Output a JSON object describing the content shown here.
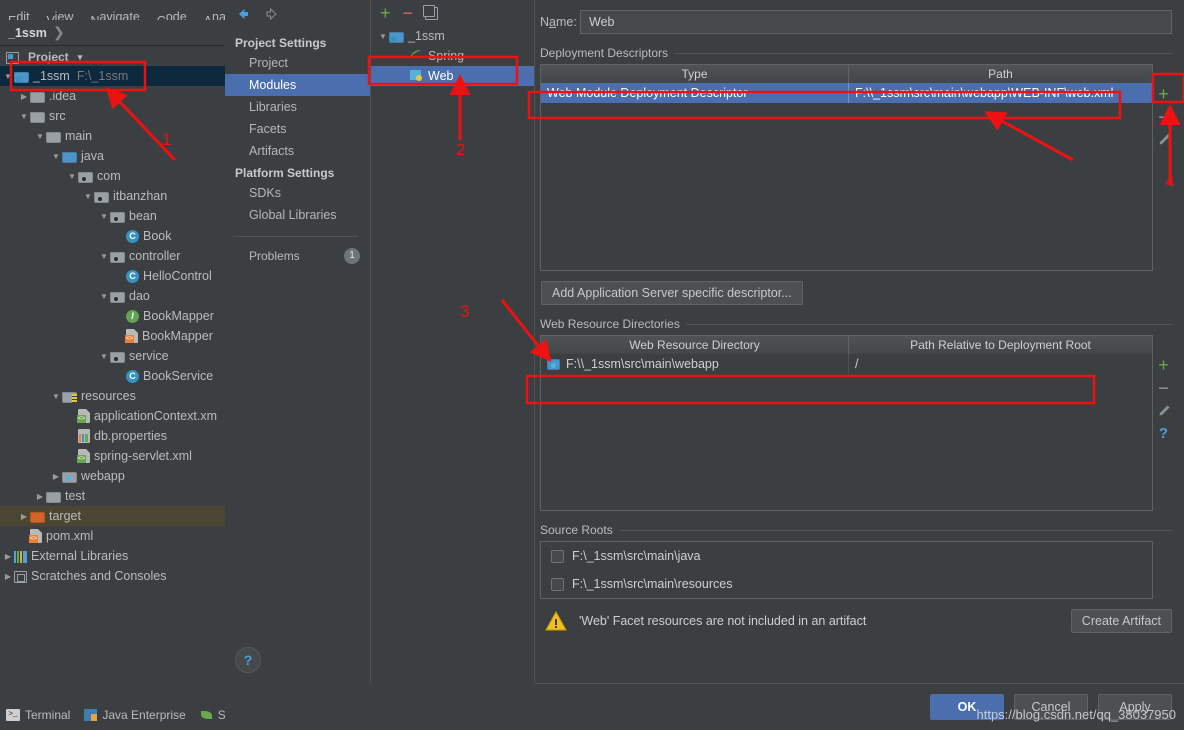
{
  "ide": {
    "menubar": [
      "Edit",
      "View",
      "Navigate",
      "Code",
      "Analyz"
    ],
    "breadcrumb": "_1ssm",
    "project_panel_title": "Project",
    "tree": [
      {
        "label": "_1ssm",
        "sub": "F:\\_1ssm",
        "icon": "module-folder-icon",
        "indent": 0,
        "twist": "down",
        "state": "selected"
      },
      {
        "label": ".idea",
        "sub": "",
        "icon": "folder-icon",
        "indent": 1,
        "twist": "right",
        "state": ""
      },
      {
        "label": "src",
        "sub": "",
        "icon": "folder-icon",
        "indent": 1,
        "twist": "down",
        "state": ""
      },
      {
        "label": "main",
        "sub": "",
        "icon": "folder-icon",
        "indent": 2,
        "twist": "down",
        "state": ""
      },
      {
        "label": "java",
        "sub": "",
        "icon": "source-folder-icon",
        "indent": 3,
        "twist": "down",
        "state": ""
      },
      {
        "label": "com",
        "sub": "",
        "icon": "package-icon",
        "indent": 4,
        "twist": "down",
        "state": ""
      },
      {
        "label": "itbanzhan",
        "sub": "",
        "icon": "package-icon",
        "indent": 5,
        "twist": "down",
        "state": ""
      },
      {
        "label": "bean",
        "sub": "",
        "icon": "package-icon",
        "indent": 6,
        "twist": "down",
        "state": ""
      },
      {
        "label": "Book",
        "sub": "",
        "icon": "java-class-icon",
        "indent": 7,
        "twist": "none",
        "state": ""
      },
      {
        "label": "controller",
        "sub": "",
        "icon": "package-icon",
        "indent": 6,
        "twist": "down",
        "state": ""
      },
      {
        "label": "HelloControl",
        "sub": "",
        "icon": "java-class-icon",
        "indent": 7,
        "twist": "none",
        "state": ""
      },
      {
        "label": "dao",
        "sub": "",
        "icon": "package-icon",
        "indent": 6,
        "twist": "down",
        "state": ""
      },
      {
        "label": "BookMapper",
        "sub": "",
        "icon": "java-interface-icon",
        "indent": 7,
        "twist": "none",
        "state": ""
      },
      {
        "label": "BookMapper",
        "sub": "",
        "icon": "xml-file-icon",
        "indent": 7,
        "twist": "none",
        "state": ""
      },
      {
        "label": "service",
        "sub": "",
        "icon": "package-icon",
        "indent": 6,
        "twist": "down",
        "state": ""
      },
      {
        "label": "BookService",
        "sub": "",
        "icon": "java-class-icon",
        "indent": 7,
        "twist": "none",
        "state": ""
      },
      {
        "label": "resources",
        "sub": "",
        "icon": "resources-folder-icon",
        "indent": 3,
        "twist": "down",
        "state": ""
      },
      {
        "label": "applicationContext.xm",
        "sub": "",
        "icon": "spring-xml-file-icon",
        "indent": 4,
        "twist": "none",
        "state": ""
      },
      {
        "label": "db.properties",
        "sub": "",
        "icon": "properties-file-icon",
        "indent": 4,
        "twist": "none",
        "state": ""
      },
      {
        "label": "spring-servlet.xml",
        "sub": "",
        "icon": "spring-xml-file-icon",
        "indent": 4,
        "twist": "none",
        "state": ""
      },
      {
        "label": "webapp",
        "sub": "",
        "icon": "webapp-folder-icon",
        "indent": 3,
        "twist": "right",
        "state": ""
      },
      {
        "label": "test",
        "sub": "",
        "icon": "folder-icon",
        "indent": 2,
        "twist": "right",
        "state": ""
      },
      {
        "label": "target",
        "sub": "",
        "icon": "excluded-folder-icon",
        "indent": 1,
        "twist": "right",
        "state": "highlight"
      },
      {
        "label": "pom.xml",
        "sub": "",
        "icon": "xml-file-icon",
        "indent": 1,
        "twist": "none",
        "state": ""
      },
      {
        "label": "External Libraries",
        "sub": "",
        "icon": "libraries-icon",
        "indent": 0,
        "twist": "right",
        "state": ""
      },
      {
        "label": "Scratches and Consoles",
        "sub": "",
        "icon": "scratches-icon",
        "indent": 0,
        "twist": "right",
        "state": ""
      }
    ],
    "status_items": [
      {
        "label": "Terminal",
        "icon": "terminal-icon"
      },
      {
        "label": "Java Enterprise",
        "icon": "java-enterprise-icon"
      },
      {
        "label": "Sp",
        "icon": "spring-icon"
      }
    ]
  },
  "dialog": {
    "nav": {
      "back_icon": "back-arrow-icon",
      "forward_icon": "forward-arrow-icon",
      "groups": [
        {
          "title": "Project Settings",
          "items": [
            {
              "label": "Project",
              "active": false
            },
            {
              "label": "Modules",
              "active": true
            },
            {
              "label": "Libraries",
              "active": false
            },
            {
              "label": "Facets",
              "active": false
            },
            {
              "label": "Artifacts",
              "active": false
            }
          ]
        },
        {
          "title": "Platform Settings",
          "items": [
            {
              "label": "SDKs",
              "active": false
            },
            {
              "label": "Global Libraries",
              "active": false
            }
          ]
        }
      ],
      "problems_label": "Problems",
      "problems_badge": "1"
    },
    "modules": {
      "toolbar": {
        "add_icon": "plus-icon",
        "remove_icon": "minus-icon",
        "copy_icon": "copy-icon"
      },
      "tree": [
        {
          "label": "_1ssm",
          "icon": "module-folder-icon",
          "indent": 0,
          "twist": "down",
          "selected": false
        },
        {
          "label": "Spring",
          "icon": "spring-facet-icon",
          "indent": 1,
          "twist": "none",
          "selected": false
        },
        {
          "label": "Web",
          "icon": "web-facet-icon",
          "indent": 1,
          "twist": "none",
          "selected": true
        }
      ]
    },
    "name": {
      "label": "Name:",
      "value": "Web"
    },
    "deployment_descriptors": {
      "section_title": "Deployment Descriptors",
      "columns": [
        "Type",
        "Path"
      ],
      "rows": [
        {
          "type": "Web Module Deployment Descriptor",
          "path": "F:\\\\_1ssm\\src\\main\\webapp\\WEB-INF\\web.xml",
          "selected": true
        }
      ],
      "side_buttons": [
        {
          "icon": "plus-icon",
          "name": "add-descriptor-button"
        },
        {
          "icon": "minus-icon",
          "name": "remove-descriptor-button"
        },
        {
          "icon": "pencil-icon",
          "name": "edit-descriptor-button"
        }
      ],
      "add_server_descriptor_button": "Add Application Server specific descriptor..."
    },
    "web_resource_directories": {
      "section_title": "Web Resource Directories",
      "columns": [
        "Web Resource Directory",
        "Path Relative to Deployment Root"
      ],
      "rows": [
        {
          "directory": "F:\\\\_1ssm\\src\\main\\webapp",
          "relative": "/",
          "icon": "folder-icon"
        }
      ],
      "side_buttons": [
        {
          "icon": "plus-icon",
          "name": "add-resource-dir-button"
        },
        {
          "icon": "minus-icon",
          "name": "remove-resource-dir-button"
        },
        {
          "icon": "pencil-icon",
          "name": "edit-resource-dir-button"
        },
        {
          "icon": "help-icon",
          "name": "resource-dir-help-button"
        }
      ]
    },
    "source_roots": {
      "section_title": "Source Roots",
      "items": [
        {
          "label": "F:\\_1ssm\\src\\main\\java",
          "checked": false
        },
        {
          "label": "F:\\_1ssm\\src\\main\\resources",
          "checked": false
        }
      ]
    },
    "warning": {
      "icon": "warning-triangle-icon",
      "text": "'Web' Facet resources are not included in an artifact",
      "action_button": "Create Artifact"
    },
    "footer": {
      "ok": "OK",
      "cancel": "Cancel",
      "apply": "Apply",
      "help_icon": "help-icon"
    }
  },
  "annotations": {
    "numbers": [
      "1",
      "2",
      "3",
      "4"
    ],
    "color": "#ee1111"
  },
  "watermark": "https://blog.csdn.net/qq_38037950"
}
